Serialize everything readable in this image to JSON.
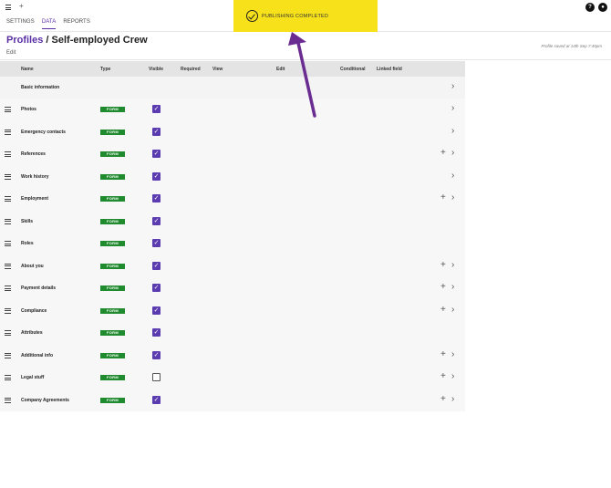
{
  "topbar": {
    "plus": "+",
    "help": "?",
    "user": "●"
  },
  "tabs": [
    {
      "label": "SETTINGS",
      "active": false
    },
    {
      "label": "DATA",
      "active": true
    },
    {
      "label": "REPORTS",
      "active": false
    }
  ],
  "page": {
    "crumb": "Profiles",
    "separator": " / ",
    "title": "Self-employed Crew",
    "edit": "Edit",
    "saved": "Profile saved at 14th Sep 7:45pm"
  },
  "table": {
    "headers": {
      "name": "Name",
      "type": "Type",
      "visible": "Visible",
      "required": "Required",
      "view": "View",
      "edit": "Edit",
      "conditional": "Conditional",
      "linked": "Linked field"
    },
    "basic": {
      "name": "Basic information",
      "chevron": "›"
    },
    "rows": [
      {
        "name": "Photos",
        "type": "FORM",
        "visible": true,
        "add": false
      },
      {
        "name": "Emergency contacts",
        "type": "FORM",
        "visible": true,
        "add": false
      },
      {
        "name": "References",
        "type": "FORM",
        "visible": true,
        "add": true
      },
      {
        "name": "Work history",
        "type": "FORM",
        "visible": true,
        "add": false
      },
      {
        "name": "Employment",
        "type": "FORM",
        "visible": true,
        "add": true
      },
      {
        "name": "Skills",
        "type": "FORM",
        "visible": true,
        "add": false
      },
      {
        "name": "Roles",
        "type": "FORM",
        "visible": true,
        "add": false
      },
      {
        "name": "About you",
        "type": "FORM",
        "visible": true,
        "add": true
      },
      {
        "name": "Payment details",
        "type": "FORM",
        "visible": true,
        "add": true
      },
      {
        "name": "Compliance",
        "type": "FORM",
        "visible": true,
        "add": true
      },
      {
        "name": "Attributes",
        "type": "FORM",
        "visible": true,
        "add": false
      },
      {
        "name": "Additional info",
        "type": "FORM",
        "visible": true,
        "add": true
      },
      {
        "name": "Legal stuff",
        "type": "FORM",
        "visible": false,
        "add": true
      },
      {
        "name": "Company Agreements",
        "type": "FORM",
        "visible": true,
        "add": true
      }
    ],
    "chevron_rows": [
      "Photos",
      "Emergency contacts",
      "References",
      "Work history",
      "Employment",
      "About you",
      "Payment details",
      "Compliance",
      "Additional info",
      "Legal stuff",
      "Company Agreements"
    ]
  },
  "toast": {
    "text": "PUBLISHING COMPLETED"
  },
  "colors": {
    "accent": "#5a2ea6",
    "checkbox": "#5b3bb0",
    "badge": "#1f8a2e",
    "toast": "#f7e11a",
    "arrow": "#6a2c91"
  },
  "icons": {
    "menu": "hamburger-menu-icon",
    "drag": "drag-handle-icon",
    "check": "checkmark-icon",
    "add": "plus-icon",
    "chevron": "chevron-right-icon",
    "toast": "check-circle-icon"
  }
}
